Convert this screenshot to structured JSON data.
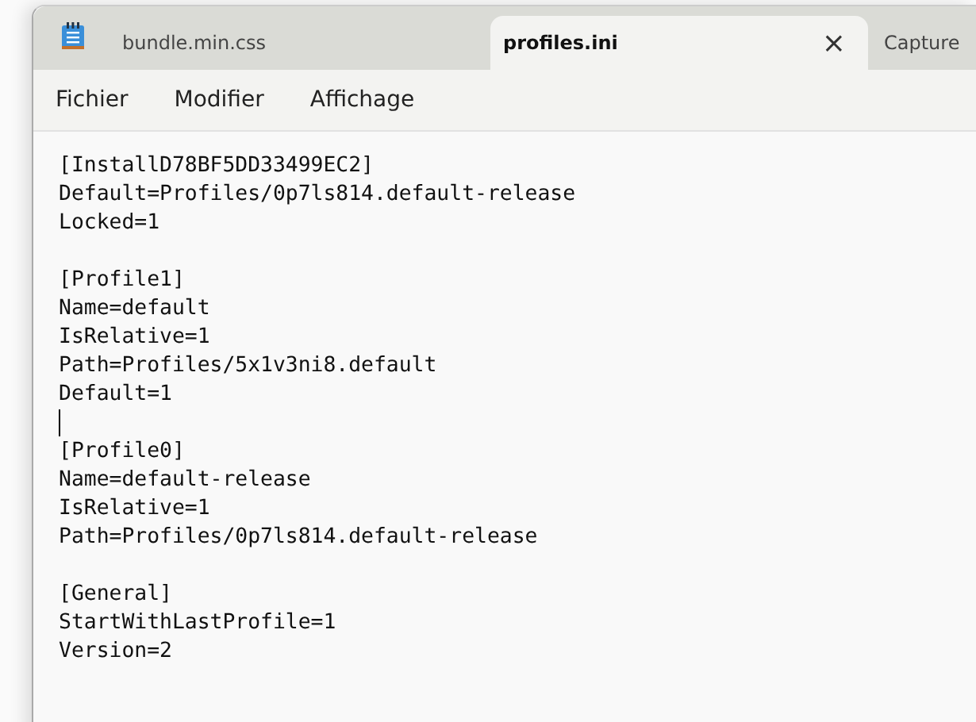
{
  "tabs": [
    {
      "label": "bundle.min.css",
      "selected": false
    },
    {
      "label": "profiles.ini",
      "selected": true
    },
    {
      "label": "Capture",
      "selected": false
    }
  ],
  "close_symbol": "×",
  "menu": [
    "Fichier",
    "Modifier",
    "Affichage"
  ],
  "editor": {
    "sections": [
      {
        "lines": [
          "[InstallD78BF5DD33499EC2]",
          "Default=Profiles/0p7ls814.default-release",
          "Locked=1"
        ],
        "caret_below": false
      },
      {
        "lines": [
          "[Profile1]",
          "Name=default",
          "IsRelative=1",
          "Path=Profiles/5x1v3ni8.default",
          "Default=1"
        ],
        "caret_below": true
      },
      {
        "lines": [
          "[Profile0]",
          "Name=default-release",
          "IsRelative=1",
          "Path=Profiles/0p7ls814.default-release"
        ],
        "caret_below": false
      },
      {
        "lines": [
          "[General]",
          "StartWithLastProfile=1",
          "Version=2"
        ],
        "caret_below": false
      }
    ]
  }
}
